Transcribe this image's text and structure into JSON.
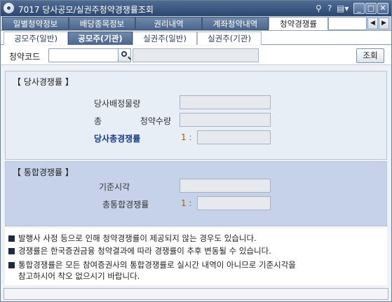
{
  "window": {
    "title": "7017 당사공모/실권주청약경쟁률조회",
    "controls": {
      "pin": "⚲",
      "help": "?",
      "menu": "▤▾",
      "minimize": "_",
      "maximize": "□",
      "close": "✕"
    }
  },
  "top_tabs": [
    {
      "label": "일별청약정보",
      "active": false
    },
    {
      "label": "배당종목정보",
      "active": false
    },
    {
      "label": "권리내역",
      "active": false
    },
    {
      "label": "계좌청약내역",
      "active": false
    },
    {
      "label": "청약경쟁률",
      "active": true
    }
  ],
  "tab_scroll": {
    "prev": "◀",
    "next": "▶"
  },
  "sub_tabs": [
    {
      "label": "공모주(일반)",
      "active": false
    },
    {
      "label": "공모주(기관)",
      "active": true
    },
    {
      "label": "실권주(일반)",
      "active": false
    },
    {
      "label": "실권주(기관)",
      "active": false
    }
  ],
  "search": {
    "label": "청약코드",
    "code_value": "",
    "name_value": "",
    "query_button": "조회"
  },
  "section_company": {
    "title": "【 당사경쟁률 】",
    "rows": [
      {
        "label": "당사배정물량",
        "value": ""
      },
      {
        "label": "총 청약수량",
        "value": ""
      },
      {
        "label": "당사총경쟁률",
        "ratio_prefix": "1 :",
        "value": ""
      }
    ]
  },
  "section_integrated": {
    "title": "【 통합경쟁률 】",
    "rows": [
      {
        "label": "기준시각",
        "value": ""
      },
      {
        "label": "총통합경쟁률",
        "ratio_prefix": "1 :",
        "value": ""
      }
    ]
  },
  "notices": [
    "발행사 사정 등으로 인해 청약경쟁률이 제공되지 않는 경우도 있습니다.",
    "경쟁률은 한국증권금융 청약결과에 따라 경쟁률이 추후 변동될 수 있습니다.",
    "통합경쟁률은 모든 참여증권사의 통합경쟁률로 실시간 내역이 아니므로 기준시각을",
    "참고하시어 착오 없으시기 바랍니다."
  ],
  "status_text": ""
}
